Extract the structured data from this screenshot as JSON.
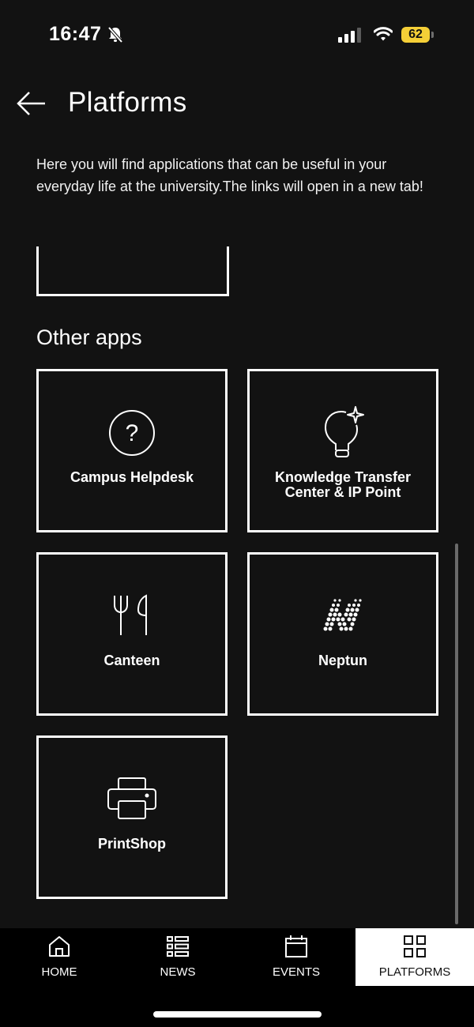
{
  "status": {
    "time": "16:47",
    "battery": "62"
  },
  "header": {
    "title": "Platforms"
  },
  "intro": "Here you will find applications that can be useful in your everyday life at the university.The links will open in a new tab!",
  "section": {
    "title": "Other apps"
  },
  "apps": [
    {
      "label_line1": "Campus Helpdesk",
      "label_line2": "",
      "icon": "question-circle-icon"
    },
    {
      "label_line1": "Knowledge Transfer",
      "label_line2": "Center & IP Point",
      "icon": "lightbulb-sparkle-icon"
    },
    {
      "label_line1": "Canteen",
      "label_line2": "",
      "icon": "fork-knife-icon"
    },
    {
      "label_line1": "Neptun",
      "label_line2": "",
      "icon": "neptun-logo-icon"
    },
    {
      "label_line1": "PrintShop",
      "label_line2": "",
      "icon": "printer-icon"
    }
  ],
  "nav": [
    {
      "label": "HOME",
      "icon": "home-icon"
    },
    {
      "label": "NEWS",
      "icon": "news-list-icon"
    },
    {
      "label": "EVENTS",
      "icon": "calendar-icon"
    },
    {
      "label": "PLATFORMS",
      "icon": "grid-icon",
      "active": true
    }
  ],
  "colors": {
    "background": "#121212",
    "text": "#ffffff",
    "battery": "#f5cf37",
    "nav_active": "#ffffff"
  }
}
